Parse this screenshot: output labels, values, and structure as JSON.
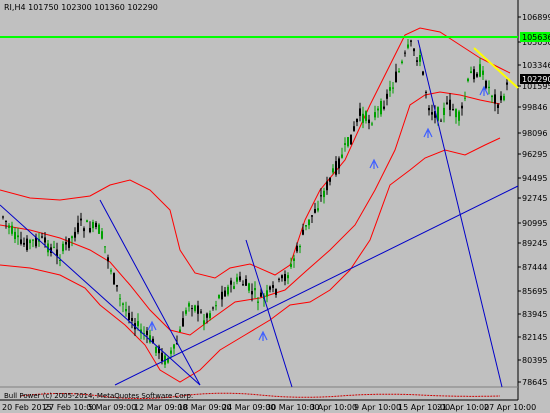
{
  "header": {
    "symbol_line": "RI,H4  101750 102300 101360 102290"
  },
  "price_axis": {
    "labels": [
      "106899",
      "105050",
      "103346",
      "101595",
      "99846",
      "98096",
      "96295",
      "94495",
      "92745",
      "90995",
      "89245",
      "87444",
      "85695",
      "83945",
      "82145",
      "80395",
      "78645"
    ],
    "current_price": "102290",
    "resistance_label": "105636"
  },
  "time_axis": {
    "labels": [
      "20 Feb 2015",
      "27 Feb 10:00",
      "5 Mar 09:00",
      "12 Mar 09:00",
      "18 Mar 09:00",
      "24 Mar 09:00",
      "30 Mar 10:00",
      "3 Apr 10:00",
      "9 Apr 10:00",
      "15 Apr 10:00",
      "21 Apr 10:00",
      "27 Apr 10:00"
    ]
  },
  "subwindow": {
    "label": "Bull Power  (c) 2005-2014, MetaQuotes Software Corp."
  },
  "colors": {
    "background": "#c0c0c0",
    "bull_candle": "#00a000",
    "bear_candle": "#000000",
    "bands": "#ff0000",
    "trendline": "#0000c8",
    "resistance": "#00ff00",
    "yellow_line": "#ffff00",
    "arrow": "#4060ff"
  }
}
